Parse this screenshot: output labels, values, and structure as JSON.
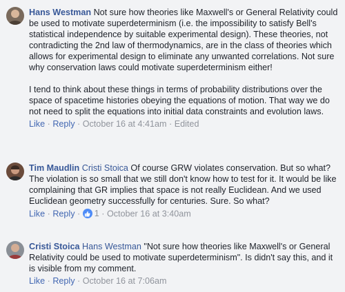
{
  "comments": [
    {
      "author": "Hans Westman",
      "mention": "",
      "paragraphs": [
        "Not sure how theories like Maxwell's or General Relativity could be used to motivate superdeterminism (i.e. the impossibility to satisfy Bell's statistical independence by suitable experimental design). These theories, not contradicting the 2nd law of thermodynamics, are in the class of theories which allows for experimental design to eliminate any unwanted correlations. Not sure why conservation laws could motivate superdeterminism either!",
        "I tend to think about these things in terms of probability distributions over the space of spacetime histories obeying the equations of motion. That way we do not need to split the equations into initial data constraints and evolution laws."
      ],
      "actions": {
        "like": "Like",
        "reply": "Reply",
        "time": "October 16 at 4:41am",
        "edited": "Edited"
      }
    },
    {
      "author": "Tim Maudlin",
      "mention": "Cristi Stoica",
      "paragraphs": [
        "Of course GRW violates conservation. But so what? The violation is so small that we still don't know how to test for it. It would be like complaining that GR implies that space is not really Euclidean. And we used Euclidean geometry successfully for centuries. Sure. So what?"
      ],
      "actions": {
        "like": "Like",
        "reply": "Reply",
        "reactions": "1",
        "time": "October 16 at 3:40am"
      }
    },
    {
      "author": "Cristi Stoica",
      "mention": "Hans Westman",
      "paragraphs": [
        "\"Not sure how theories like Maxwell's or General Relativity could be used to motivate superdeterminism\". Is didn't say this, and it is visible from my comment."
      ],
      "actions": {
        "like": "Like",
        "reply": "Reply",
        "time": "October 16 at 7:06am"
      }
    }
  ],
  "colors": {
    "link": "#385898",
    "meta": "#90949c",
    "action": "#4267b2",
    "like_badge": "#4f8cf7"
  }
}
